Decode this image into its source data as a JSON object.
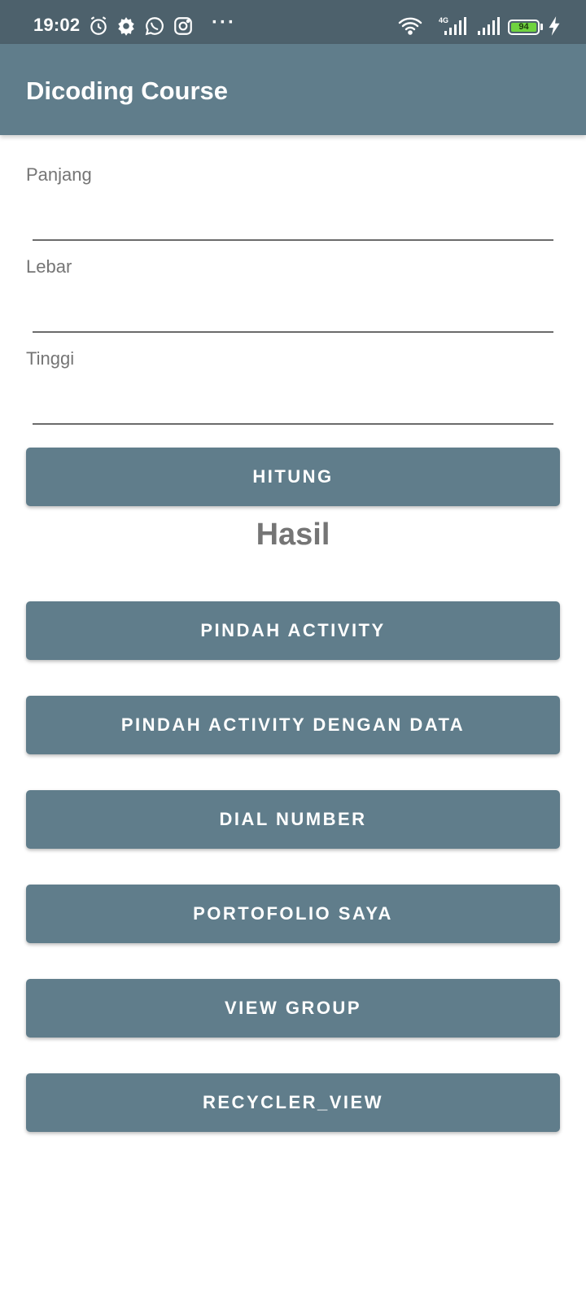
{
  "status_bar": {
    "time": "19:02",
    "network_label": "4G",
    "battery_level": "94",
    "icons": [
      "alarm-icon",
      "settings-icon",
      "whatsapp-icon",
      "instagram-icon",
      "more-icon",
      "wifi-icon",
      "signal-icon",
      "signal-icon",
      "battery-icon",
      "charging-icon"
    ]
  },
  "app_bar": {
    "title": "Dicoding Course",
    "color": "#607d8b"
  },
  "form": {
    "fields": [
      {
        "label": "Panjang",
        "value": ""
      },
      {
        "label": "Lebar",
        "value": ""
      },
      {
        "label": "Tinggi",
        "value": ""
      }
    ],
    "calculate_label": "HITUNG",
    "result_label": "Hasil"
  },
  "buttons": [
    "PINDAH ACTIVITY",
    "PINDAH ACTIVITY DENGAN DATA",
    "DIAL NUMBER",
    "PORTOFOLIO SAYA",
    "VIEW GROUP",
    "RECYCLER_VIEW"
  ],
  "colors": {
    "primary": "#607d8b",
    "status_bar": "#4d616c",
    "battery": "#6fd33f"
  }
}
